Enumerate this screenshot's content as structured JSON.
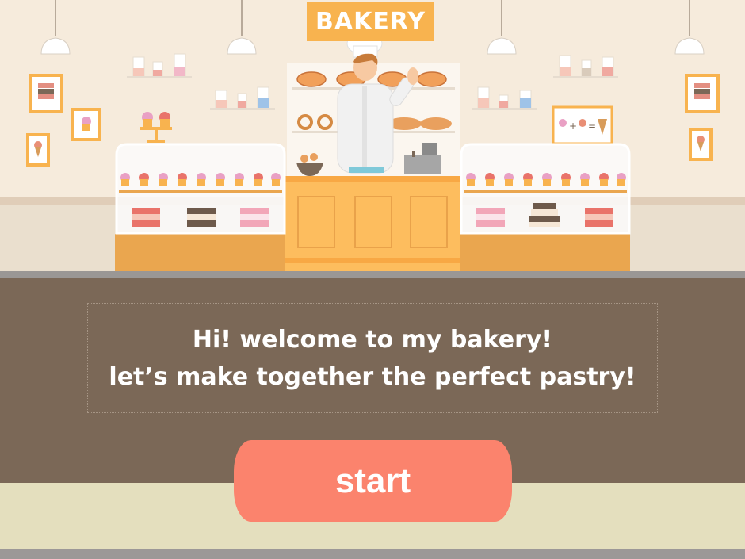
{
  "sign": {
    "label": "BAKERY"
  },
  "dialog": {
    "line1": "Hi! welcome to my bakery!",
    "line2": "let’s make together the perfect pastry!"
  },
  "start_button": {
    "label": "start"
  },
  "colors": {
    "wall": "#f6ebdc",
    "panel": "#7b6857",
    "accent": "#f8b34f",
    "button": "#fb836d",
    "floor": "#e4dfbe"
  },
  "icons": [
    "ceiling-lamp-icon",
    "cake-picture-icon",
    "cupcake-picture-icon",
    "icecream-picture-icon",
    "chef-icon",
    "cash-register-icon",
    "pie-icon",
    "croissant-icon",
    "cupcake-icon",
    "layer-cake-icon",
    "recipe-board-icon"
  ]
}
